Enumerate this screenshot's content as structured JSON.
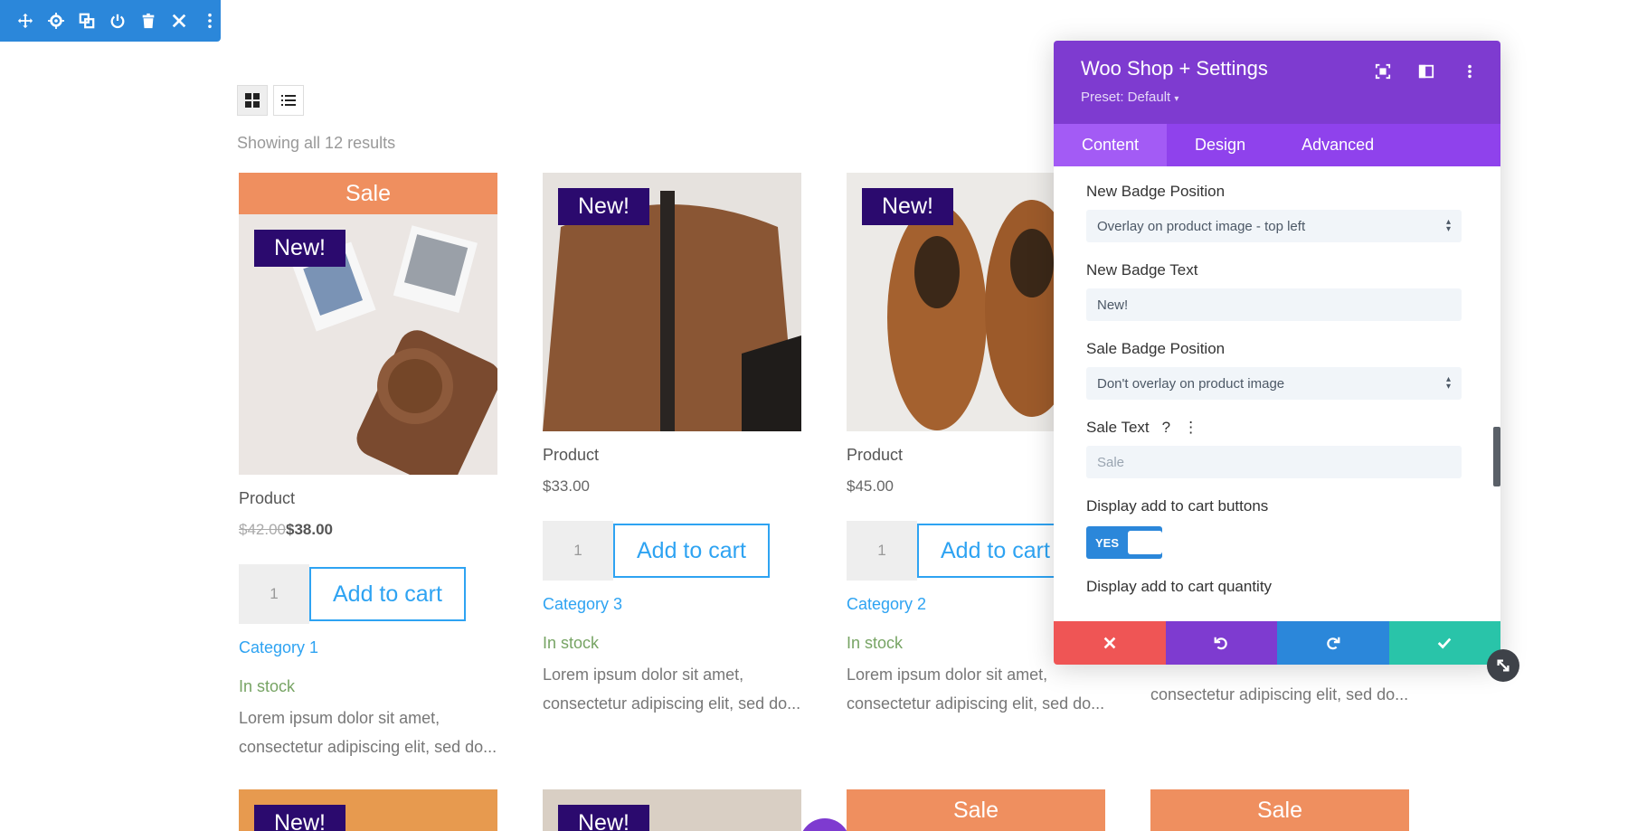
{
  "module_toolbar": {
    "icons": [
      "move-icon",
      "gear-icon",
      "duplicate-icon",
      "power-icon",
      "trash-icon",
      "close-icon",
      "more-vertical-icon"
    ]
  },
  "shop": {
    "result_count": "Showing all 12 results",
    "view_modes": [
      "grid-view-icon",
      "list-view-icon"
    ],
    "products": [
      {
        "sale_banner": "Sale",
        "badge": "New!",
        "title": "Product",
        "price_old": "$42.00",
        "price_new": "$38.00",
        "qty": "1",
        "add_to_cart": "Add to cart",
        "category": "Category 1",
        "stock": "In stock",
        "desc_line1": "Lorem ipsum dolor sit amet,",
        "desc_line2": "consectetur adipiscing elit, sed do..."
      },
      {
        "badge": "New!",
        "title": "Product",
        "price": "$33.00",
        "qty": "1",
        "add_to_cart": "Add to cart",
        "category": "Category 3",
        "stock": "In stock",
        "desc_line1": "Lorem ipsum dolor sit amet,",
        "desc_line2": "consectetur adipiscing elit, sed do..."
      },
      {
        "badge": "New!",
        "title": "Product",
        "price": "$45.00",
        "qty": "1",
        "add_to_cart": "Add to cart",
        "category": "Category 2",
        "stock": "In stock",
        "desc_line1": "Lorem ipsum dolor sit amet,",
        "desc_line2": "consectetur adipiscing elit, sed do..."
      },
      {
        "desc_line2": "consectetur adipiscing elit, sed do..."
      }
    ],
    "row2": [
      {
        "badge": "New!"
      },
      {
        "badge": "New!"
      },
      {
        "sale_banner": "Sale"
      },
      {
        "sale_banner": "Sale"
      }
    ]
  },
  "panel": {
    "title": "Woo Shop + Settings",
    "preset": "Preset: Default",
    "header_icons": [
      "focus-icon",
      "sidebar-layout-icon",
      "more-vertical-icon"
    ],
    "tabs": [
      "Content",
      "Design",
      "Advanced"
    ],
    "active_tab": "Content",
    "fields": {
      "new_badge_position_label": "New Badge Position",
      "new_badge_position_value": "Overlay on product image - top left",
      "new_badge_text_label": "New Badge Text",
      "new_badge_text_value": "New!",
      "sale_badge_position_label": "Sale Badge Position",
      "sale_badge_position_value": "Don't overlay on product image",
      "sale_text_label": "Sale Text",
      "sale_text_placeholder": "Sale",
      "display_add_to_cart_label": "Display add to cart buttons",
      "display_add_to_cart_toggle": "YES",
      "display_qty_label": "Display add to cart quantity"
    },
    "footer_icons": [
      "close-icon",
      "undo-icon",
      "redo-icon",
      "check-icon"
    ]
  },
  "colors": {
    "divi_blue": "#2b87da",
    "panel_purple": "#7e3bd0",
    "tab_purple": "#8f42ec",
    "sale_orange": "#ef8f5f",
    "badge_navy": "#2b0a6e",
    "link_blue": "#2ea3f2",
    "stock_green": "#77a464",
    "cancel_red": "#ef5555",
    "save_green": "#29c4a9"
  }
}
